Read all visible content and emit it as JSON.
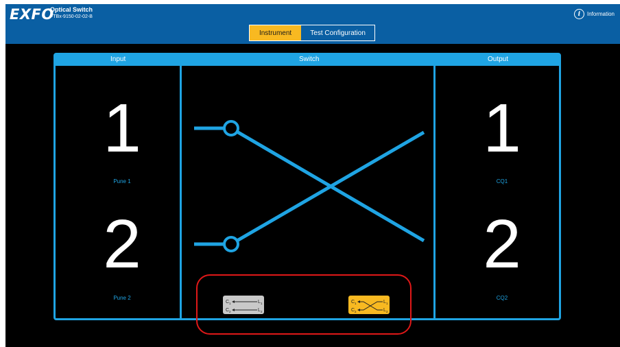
{
  "header": {
    "logo": "EXFO",
    "title": "Optical Switch",
    "subtitle": "FTBx-9150-02-02-B",
    "info_label": "Information",
    "info_icon": "info-icon"
  },
  "tabs": [
    {
      "label": "Instrument",
      "active": true
    },
    {
      "label": "Test Configuration",
      "active": false
    }
  ],
  "panel": {
    "input_title": "Input",
    "switch_title": "Switch",
    "output_title": "Output"
  },
  "inputs": [
    {
      "number": "1",
      "label": "Pune 1"
    },
    {
      "number": "2",
      "label": "Pune 2"
    }
  ],
  "outputs": [
    {
      "number": "1",
      "label": "CQ1"
    },
    {
      "number": "2",
      "label": "CQ2"
    }
  ],
  "switch_state": "cross",
  "mode_buttons": {
    "bar": {
      "state": "bar",
      "selected": false
    },
    "cross": {
      "state": "cross",
      "selected": true
    }
  },
  "colors": {
    "header_bg": "#0a5fa3",
    "accent": "#1fa4e3",
    "active_tab": "#f8b921",
    "highlight": "#e01818"
  }
}
